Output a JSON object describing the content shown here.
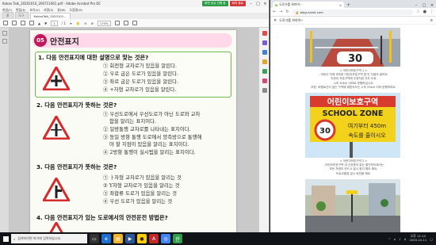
{
  "pdf": {
    "title": "Kakao Talk_20201010_200711061.pdf - Adobe Acrobat Pro DC",
    "badge_green": "화면 공유 진행 중",
    "badge_red": "회의 종료",
    "menu": [
      "파일(F)",
      "편집(E)",
      "보기(V)",
      "서명(S)",
      "창(W)",
      "도움말(H)"
    ],
    "tabs": [
      "홈",
      "도구",
      "KakaoTalk_2020101..."
    ],
    "page_field": "1",
    "page_total": "/ 1",
    "zoom": "170%",
    "page_heading_num": "05",
    "page_heading": "안전표지",
    "questions": [
      {
        "title": "1. 다음 안전표지에 대한 설명으로 맞는 것은?",
        "options": [
          "① 회전형 교차로가 있음을 알린다.",
          "② 우로 굽은 도로가 있음을 알린다.",
          "③ 좌로 굽은 도로가 있음을 알린다.",
          "④ +자형 교차로가 있음을 알린다."
        ]
      },
      {
        "title": "2. 다음 안전표지가 뜻하는 것은?",
        "options": [
          "① 우선도로에서 우선도로가 아닌 도로와 교차",
          "함을 알리는 표지이다.",
          "② 일방통행 교차로를 나타내는 표지이다.",
          "③ 동일 방향 통행 도로에서 양측방으로 통행해",
          "야 할 지점이 있음을 알리는 표지이다.",
          "④ 2방향 통행이 실시됨을 알리는 표지이다."
        ]
      },
      {
        "title": "3. 다음 안전표지가 뜻하는 것은?",
        "options": [
          "① ㅏ자형 교차로가 있음을 알리는 것",
          "② Y자형 교차로가 있음을 알리는 것",
          "③ 좌합류 도로가 있음을 알리는 것",
          "④ 우선 도로가 있음을 알리는 것"
        ]
      },
      {
        "title": "4. 다음 안전표지가 있는 도로에서의 안전운전 방법은?",
        "options": []
      }
    ]
  },
  "browser": {
    "tab_title": "도로가를 위하여~",
    "new_tab": "+",
    "url": "blog.naver.com",
    "blog_name": "도로가를 위하여~",
    "caption1": [
      "< 어린이보호구역 1 >",
      "- 어린이 차에 과속한 어린이보호구역 법 빈 지점의 알려요.",
      "어린이 보호구역에 주정차된 차도 도로",
      "시속 30km 이하로 운행하십시오.",
      "또한, 보행로선이 없는 구역에 제한속도는 시속 20km 이하 운행하여요."
    ],
    "sign_board": {
      "line1": "어린이보호구역",
      "line2": "SCHOOL ZONE",
      "speed": "30",
      "line3": "여기부터 450m",
      "line4": "속도를 줄이시오"
    },
    "road_speed": "30",
    "caption2": [
      "< 어린이보호구역 2 >",
      "- 어린이보호구역 내 신호등이 없는 횡단보도에서는",
      "모든 차량이 반드시 일시 정지 해야 해요.",
      "도로교통법 일시 위반을 해요."
    ]
  },
  "taskbar": {
    "search_placeholder": "검색하려면 여기에 입력하십시오.",
    "time": "오후 11:14",
    "date": "2020-10-11"
  }
}
